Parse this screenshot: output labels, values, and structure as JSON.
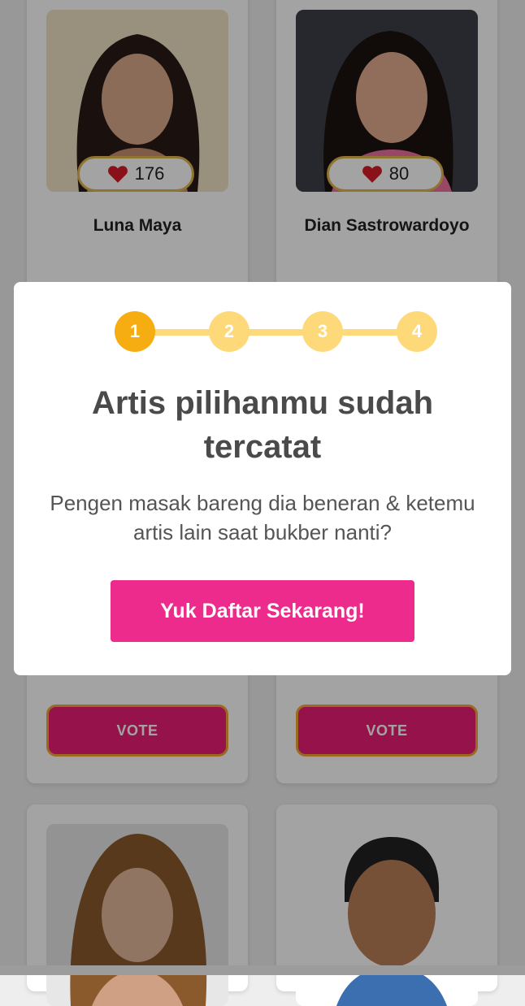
{
  "cards": [
    {
      "name": "Luna Maya",
      "likes": "176"
    },
    {
      "name": "Dian Sastrowardoyo",
      "likes": "80"
    }
  ],
  "vote_label": "VOTE",
  "modal": {
    "steps": [
      "1",
      "2",
      "3",
      "4"
    ],
    "active_step": 1,
    "title": "Artis pilihanmu sudah tercatat",
    "subtitle": "Pengen masak bareng dia beneran & ketemu artis lain saat bukber nanti?",
    "cta_label": "Yuk Daftar Sekarang!"
  },
  "colors": {
    "vote_button": "#e91e75",
    "cta_button": "#ec2b8c",
    "step_active": "#f6ad12",
    "step_inactive": "#fdd97a",
    "like_border": "#e0b44b"
  }
}
